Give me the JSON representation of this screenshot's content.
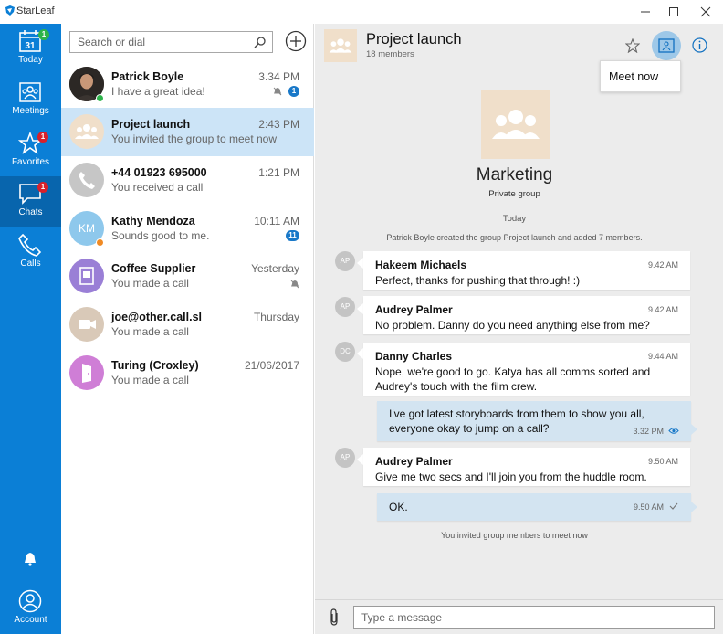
{
  "app": {
    "title": "StarLeaf"
  },
  "window_controls": [
    "minimize-icon",
    "maximize-icon",
    "close-icon"
  ],
  "colors": {
    "rail": "#0b7fd6",
    "rail_active": "#0865ad",
    "selected_row": "#cce4f7",
    "own_bubble": "#d3e4f1",
    "group_avatar": "#f0dfca"
  },
  "rail": {
    "items": [
      {
        "label": "Today",
        "icon": "calendar-icon",
        "calendar_day": "31",
        "badge": "1",
        "badge_color": "green"
      },
      {
        "label": "Meetings",
        "icon": "meetings-icon"
      },
      {
        "label": "Favorites",
        "icon": "star-icon",
        "badge": "1",
        "badge_color": "red"
      },
      {
        "label": "Chats",
        "icon": "chat-icon",
        "badge": "1",
        "badge_color": "red",
        "active": true
      },
      {
        "label": "Calls",
        "icon": "phone-icon"
      }
    ],
    "bottom": {
      "bell": "bell-icon",
      "account_label": "Account"
    }
  },
  "search": {
    "placeholder": "Search or dial"
  },
  "chats": [
    {
      "name": "Patrick Boyle",
      "subtitle": "I have a great idea!",
      "time": "3.34 PM",
      "badge": "1",
      "muted": true,
      "status": "online"
    },
    {
      "name": "Project launch",
      "subtitle": "You invited the group to meet now",
      "time": "2:43 PM",
      "selected": true
    },
    {
      "name": "+44 01923 695000",
      "subtitle": "You received a call",
      "time": "1:21 PM"
    },
    {
      "name": "Kathy Mendoza",
      "subtitle": "Sounds good to me.",
      "time": "10:11 AM",
      "badge": "11",
      "initials": "KM",
      "status": "away"
    },
    {
      "name": "Coffee Supplier",
      "subtitle": "You made a call",
      "time": "Yesterday",
      "muted": true
    },
    {
      "name": "joe@other.call.sl",
      "subtitle": "You made a call",
      "time": "Thursday"
    },
    {
      "name": "Turing (Croxley)",
      "subtitle": "You made a call",
      "time": "21/06/2017"
    }
  ],
  "conversation": {
    "title": "Project launch",
    "members": "18 members",
    "meet_now": "Meet now",
    "group_name": "Marketing",
    "group_kind": "Private group",
    "day": "Today",
    "created_notice": "Patrick Boyle created the group Project launch and added 7 members.",
    "messages": [
      {
        "initials": "AP",
        "sender": "Hakeem Michaels",
        "time": "9.42 AM",
        "lines": [
          "Perfect, thanks for pushing that through! :)"
        ]
      },
      {
        "initials": "AP",
        "sender": "Audrey Palmer",
        "time": "9.42 AM",
        "lines": [
          "No problem. Danny do you need anything else from me?"
        ]
      },
      {
        "initials": "DC",
        "sender": "Danny Charles",
        "time": "9.44 AM",
        "lines": [
          "Nope, we're good to go. Katya has all comms sorted and",
          "Audrey's touch with the film crew."
        ]
      },
      {
        "mine": true,
        "time": "3.32 PM",
        "lines": [
          "I've got latest storyboards from them to show you all,",
          "everyone okay to jump on a call?"
        ],
        "status_icon": "eye-icon"
      },
      {
        "initials": "AP",
        "sender": "Audrey Palmer",
        "time": "9.50 AM",
        "lines": [
          "Give me two secs and I'll join you from the huddle room."
        ]
      },
      {
        "mine": true,
        "time": "9.50 AM",
        "lines": [
          "OK."
        ],
        "status_icon": "check-icon"
      }
    ],
    "invite_notice": "You invited group members to meet now",
    "composer_placeholder": "Type a message"
  }
}
